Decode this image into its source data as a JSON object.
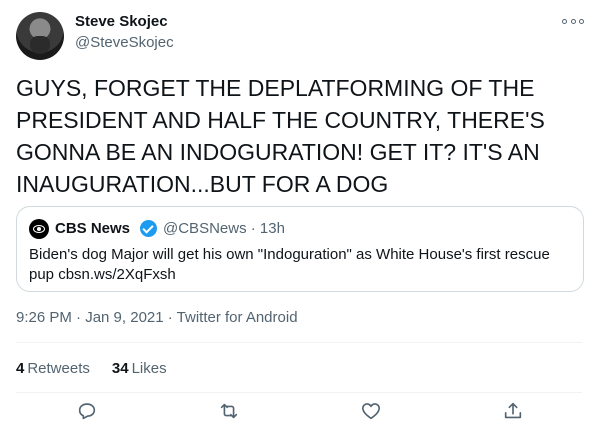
{
  "author": {
    "display_name": "Steve Skojec",
    "handle": "@SteveSkojec"
  },
  "tweet": {
    "text": "GUYS, FORGET THE DEPLATFORMING OF THE PRESIDENT AND HALF THE COUNTRY, THERE'S GONNA BE AN INDOGURATION! GET IT? IT'S AN INAUGURATION...BUT FOR A DOG"
  },
  "quote": {
    "name": "CBS News",
    "handle_time": "@CBSNews · 13h",
    "text": "Biden's dog Major will get his own \"Indoguration\" as White House's first rescue pup cbsn.ws/2XqFxsh"
  },
  "meta": {
    "timestamp": "9:26 PM · Jan 9, 2021 · Twitter for Android"
  },
  "stats": {
    "retweets_count": "4",
    "retweets_label": "Retweets",
    "likes_count": "34",
    "likes_label": "Likes"
  },
  "actions": [
    "reply-icon",
    "retweet-icon",
    "like-icon",
    "share-icon"
  ],
  "colors": {
    "secondary_text": "#536471",
    "verified": "#1d9bf0",
    "border": "#cfd9de"
  }
}
